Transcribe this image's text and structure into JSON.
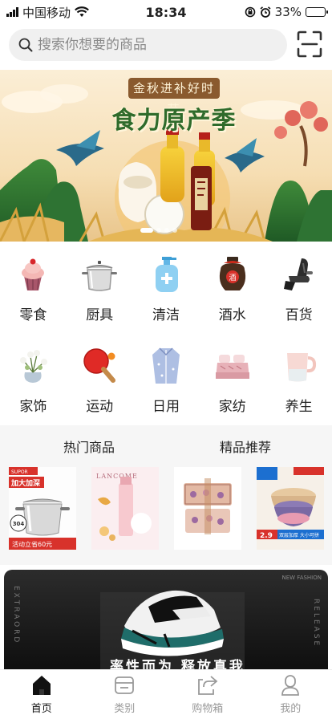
{
  "status_bar": {
    "carrier": "中国移动",
    "time": "18:34",
    "battery": "33%",
    "battery_level": 0.33
  },
  "search": {
    "placeholder": "搜索你想要的商品",
    "icon": "search-icon",
    "scan_icon": "scan-icon"
  },
  "banner": {
    "tag": "金秋进补好时节",
    "title": "食力原产季",
    "pages": 4,
    "active_page": 1
  },
  "categories": [
    {
      "label": "零食",
      "icon": "cupcake-icon"
    },
    {
      "label": "厨具",
      "icon": "pot-icon"
    },
    {
      "label": "清洁",
      "icon": "soap-bottle-icon"
    },
    {
      "label": "酒水",
      "icon": "wine-jar-icon"
    },
    {
      "label": "百货",
      "icon": "massage-chair-icon"
    },
    {
      "label": "家饰",
      "icon": "flower-vase-icon"
    },
    {
      "label": "运动",
      "icon": "ping-pong-icon"
    },
    {
      "label": "日用",
      "icon": "clothing-icon"
    },
    {
      "label": "家纺",
      "icon": "bedding-icon"
    },
    {
      "label": "养生",
      "icon": "mug-icon"
    }
  ],
  "sections": {
    "hot_title": "热门商品",
    "recommend_title": "精品推荐"
  },
  "products": [
    {
      "name": "stainless-pot-product",
      "badge": "加大加深",
      "brand": "SUPOR",
      "size": "304",
      "promo": "活动立省60元"
    },
    {
      "name": "lancome-serum-product",
      "brand": "LANCOME"
    },
    {
      "name": "gift-box-product"
    },
    {
      "name": "bowl-set-product",
      "price": "2.9",
      "tag": "双层加厚 大小可拼"
    }
  ],
  "ad": {
    "caption": "率性而为 释放真我",
    "side_left": "EXTRAORD",
    "side_right": "RELEASE",
    "corner": "NEW FASHION"
  },
  "tabs": [
    {
      "label": "首页",
      "icon": "home-icon",
      "active": true
    },
    {
      "label": "类别",
      "icon": "category-icon",
      "active": false
    },
    {
      "label": "购物箱",
      "icon": "share-box-icon",
      "active": false
    },
    {
      "label": "我的",
      "icon": "profile-icon",
      "active": false
    }
  ],
  "colors": {
    "accent": "#2f6b2b",
    "tab_active": "#111111",
    "tab_inactive": "#999999",
    "promo_red": "#d8322b"
  }
}
